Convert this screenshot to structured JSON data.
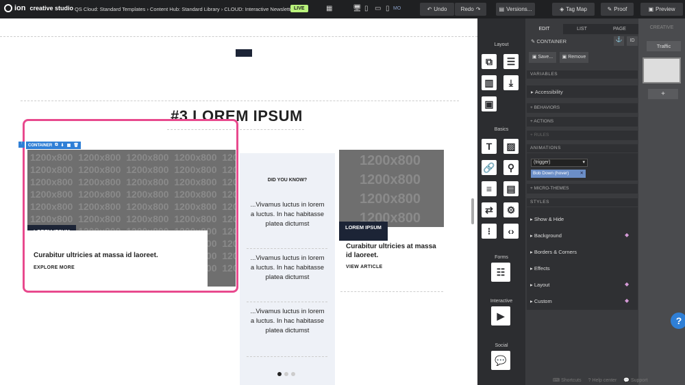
{
  "topbar": {
    "logo": "ion",
    "brand": "creative studio",
    "breadcrumb": "QS Cloud: Standard Templates › Content Hub: Standard Library › CLOUD: Interactive Newsletter",
    "live_badge": "LIVE",
    "device_label": "MO",
    "undo": "Undo",
    "redo": "Redo",
    "versions": "Versions...",
    "tag_map": "Tag Map",
    "proof": "Proof",
    "preview": "Preview"
  },
  "canvas": {
    "heading": "#3 LOREM IPSUM",
    "container_tag": "CONTAINER",
    "placeholder": "1200x800",
    "card1": {
      "label": "LOREM IPSUM",
      "headline": "Curabitur ultricies at massa id laoreet.",
      "link": "EXPLORE MORE"
    },
    "mid": {
      "title": "DID YOU KNOW?",
      "t1": "...Vivamus luctus in lorem a luctus. In hac habitasse platea dictumst",
      "t2": "...Vivamus luctus in lorem a luctus. In hac habitasse platea dictumst",
      "t3": "...Vivamus luctus in lorem a luctus. In hac habitasse platea dictumst"
    },
    "card3": {
      "label": "LOREM IPSUM",
      "headline": "Curabitur ultricies at massa id laoreet.",
      "link": "VIEW ARTICLE"
    }
  },
  "tools": {
    "layout": "Layout",
    "basics": "Basics",
    "forms": "Forms",
    "interactive": "Interactive",
    "social": "Social"
  },
  "panel": {
    "tabs": [
      "EDIT",
      "LIST",
      "PAGE"
    ],
    "creative_tab": "CREATIVE",
    "traffic": "Traffic",
    "plus": "+",
    "container": "CONTAINER",
    "save": "Save...",
    "remove": "Remove",
    "variables": "VARIABLES",
    "accessibility": "Accessibility",
    "behaviors": "+ BEHAVIORS",
    "actions": "+ ACTIONS",
    "rules": "+ RULES",
    "animations": "ANIMATIONS",
    "trigger": "(trigger)",
    "anim_tag": "Bob Down (hover)",
    "microthemes": "+ MICRO-THEMES",
    "styles": "STYLES",
    "style_items": [
      "Show & Hide",
      "Background",
      "Borders & Corners",
      "Effects",
      "Layout",
      "Custom"
    ],
    "id_btn": "ID"
  },
  "footer": {
    "shortcuts": "Shortcuts",
    "help": "Help center",
    "support": "Support"
  },
  "help_btn": "?"
}
